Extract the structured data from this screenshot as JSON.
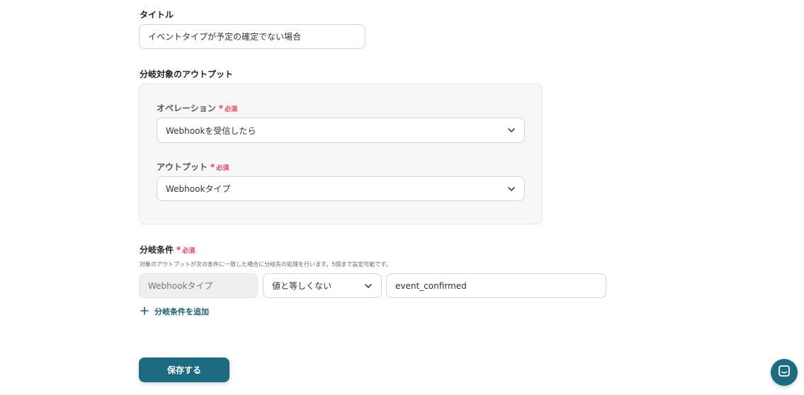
{
  "title_section": {
    "label": "タイトル",
    "value": "イベントタイプが予定の確定でない場合"
  },
  "output_section": {
    "label": "分岐対象のアウトプット",
    "operation": {
      "label": "オペレーション",
      "required_mark": "*",
      "required_text": "必須",
      "value": "Webhookを受信したら"
    },
    "output": {
      "label": "アウトプット",
      "required_mark": "*",
      "required_text": "必須",
      "value": "Webhookタイプ"
    }
  },
  "condition_section": {
    "label": "分岐条件",
    "required_mark": "*",
    "required_text": "必須",
    "hint": "対象のアウトプットが次の条件に一致した場合に分岐先の処理を行います。5個まで設定可能です。",
    "field": "Webhookタイプ",
    "operator": "値と等しくない",
    "value": "event_confirmed",
    "add_label": "分岐条件を追加"
  },
  "actions": {
    "save_label": "保存する"
  },
  "colors": {
    "accent": "#1c6b80",
    "required": "#e0415a"
  },
  "icons": {
    "chevron": "chevron-down-icon",
    "plus": "plus-icon",
    "chat": "chat-icon"
  }
}
